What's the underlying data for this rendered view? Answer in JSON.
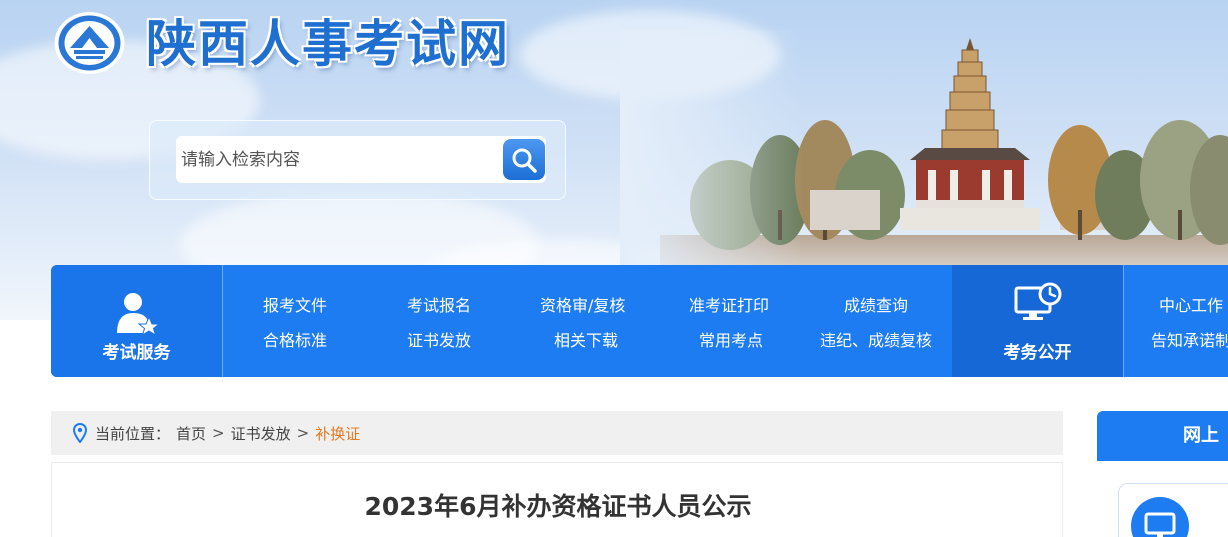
{
  "site": {
    "title": "陕西人事考试网"
  },
  "search": {
    "placeholder": "请输入检索内容"
  },
  "nav": {
    "service_label": "考试服务",
    "links_row1": [
      "报考文件",
      "考试报名",
      "资格审/复核",
      "准考证打印",
      "成绩查询"
    ],
    "links_row2": [
      "合格标准",
      "证书发放",
      "相关下载",
      "常用考点",
      "违纪、成绩复核"
    ],
    "public_label": "考务公开",
    "extra_row1": "中心工作",
    "extra_row2": "告知承诺制"
  },
  "breadcrumb": {
    "prefix": "当前位置：",
    "items": [
      "首页",
      "证书发放"
    ],
    "separator": ">",
    "current": "补换证"
  },
  "article": {
    "title": "2023年6月补办资格证书人员公示"
  },
  "sidebar": {
    "header": "网上"
  },
  "colors": {
    "brand_blue": "#1e7cf2",
    "title_blue": "#1f6fd1",
    "breadcrumb_current": "#e07b22"
  },
  "icons": [
    "logo-emblem-icon",
    "search-icon",
    "user-service-icon",
    "monitor-clock-icon",
    "location-pin-icon",
    "monitor-icon"
  ]
}
